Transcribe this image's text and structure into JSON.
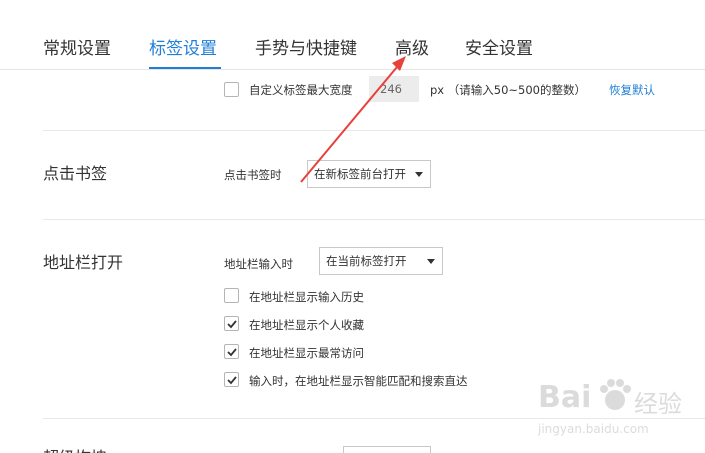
{
  "tabs": [
    {
      "label": "常规设置",
      "active": false
    },
    {
      "label": "标签设置",
      "active": true
    },
    {
      "label": "手势与快捷键",
      "active": false
    },
    {
      "label": "高级",
      "active": false
    },
    {
      "label": "安全设置",
      "active": false
    }
  ],
  "tab_width": {
    "checkbox_label": "自定义标签最大宽度",
    "value": "246",
    "unit_hint": "px （请输入50~500的整数）",
    "reset_link": "恢复默认",
    "checked": false
  },
  "bookmark_click": {
    "section_title": "点击书签",
    "label": "点击书签时",
    "selected": "在新标签前台打开"
  },
  "address_bar": {
    "section_title": "地址栏打开",
    "label": "地址栏输入时",
    "selected": "在当前标签打开",
    "options": [
      {
        "label": "在地址栏显示输入历史",
        "checked": false
      },
      {
        "label": "在地址栏显示个人收藏",
        "checked": true
      },
      {
        "label": "在地址栏显示最常访问",
        "checked": true
      },
      {
        "label": "输入时，在地址栏显示智能匹配和搜索直达",
        "checked": true
      }
    ]
  },
  "next_section": {
    "section_title": "超级拖拽"
  },
  "watermark": {
    "brand": "Bai",
    "brand_suffix": "经验",
    "url": "jingyan.baidu.com"
  },
  "colors": {
    "accent": "#1f7fd6",
    "annotation_arrow": "#e8413a"
  }
}
